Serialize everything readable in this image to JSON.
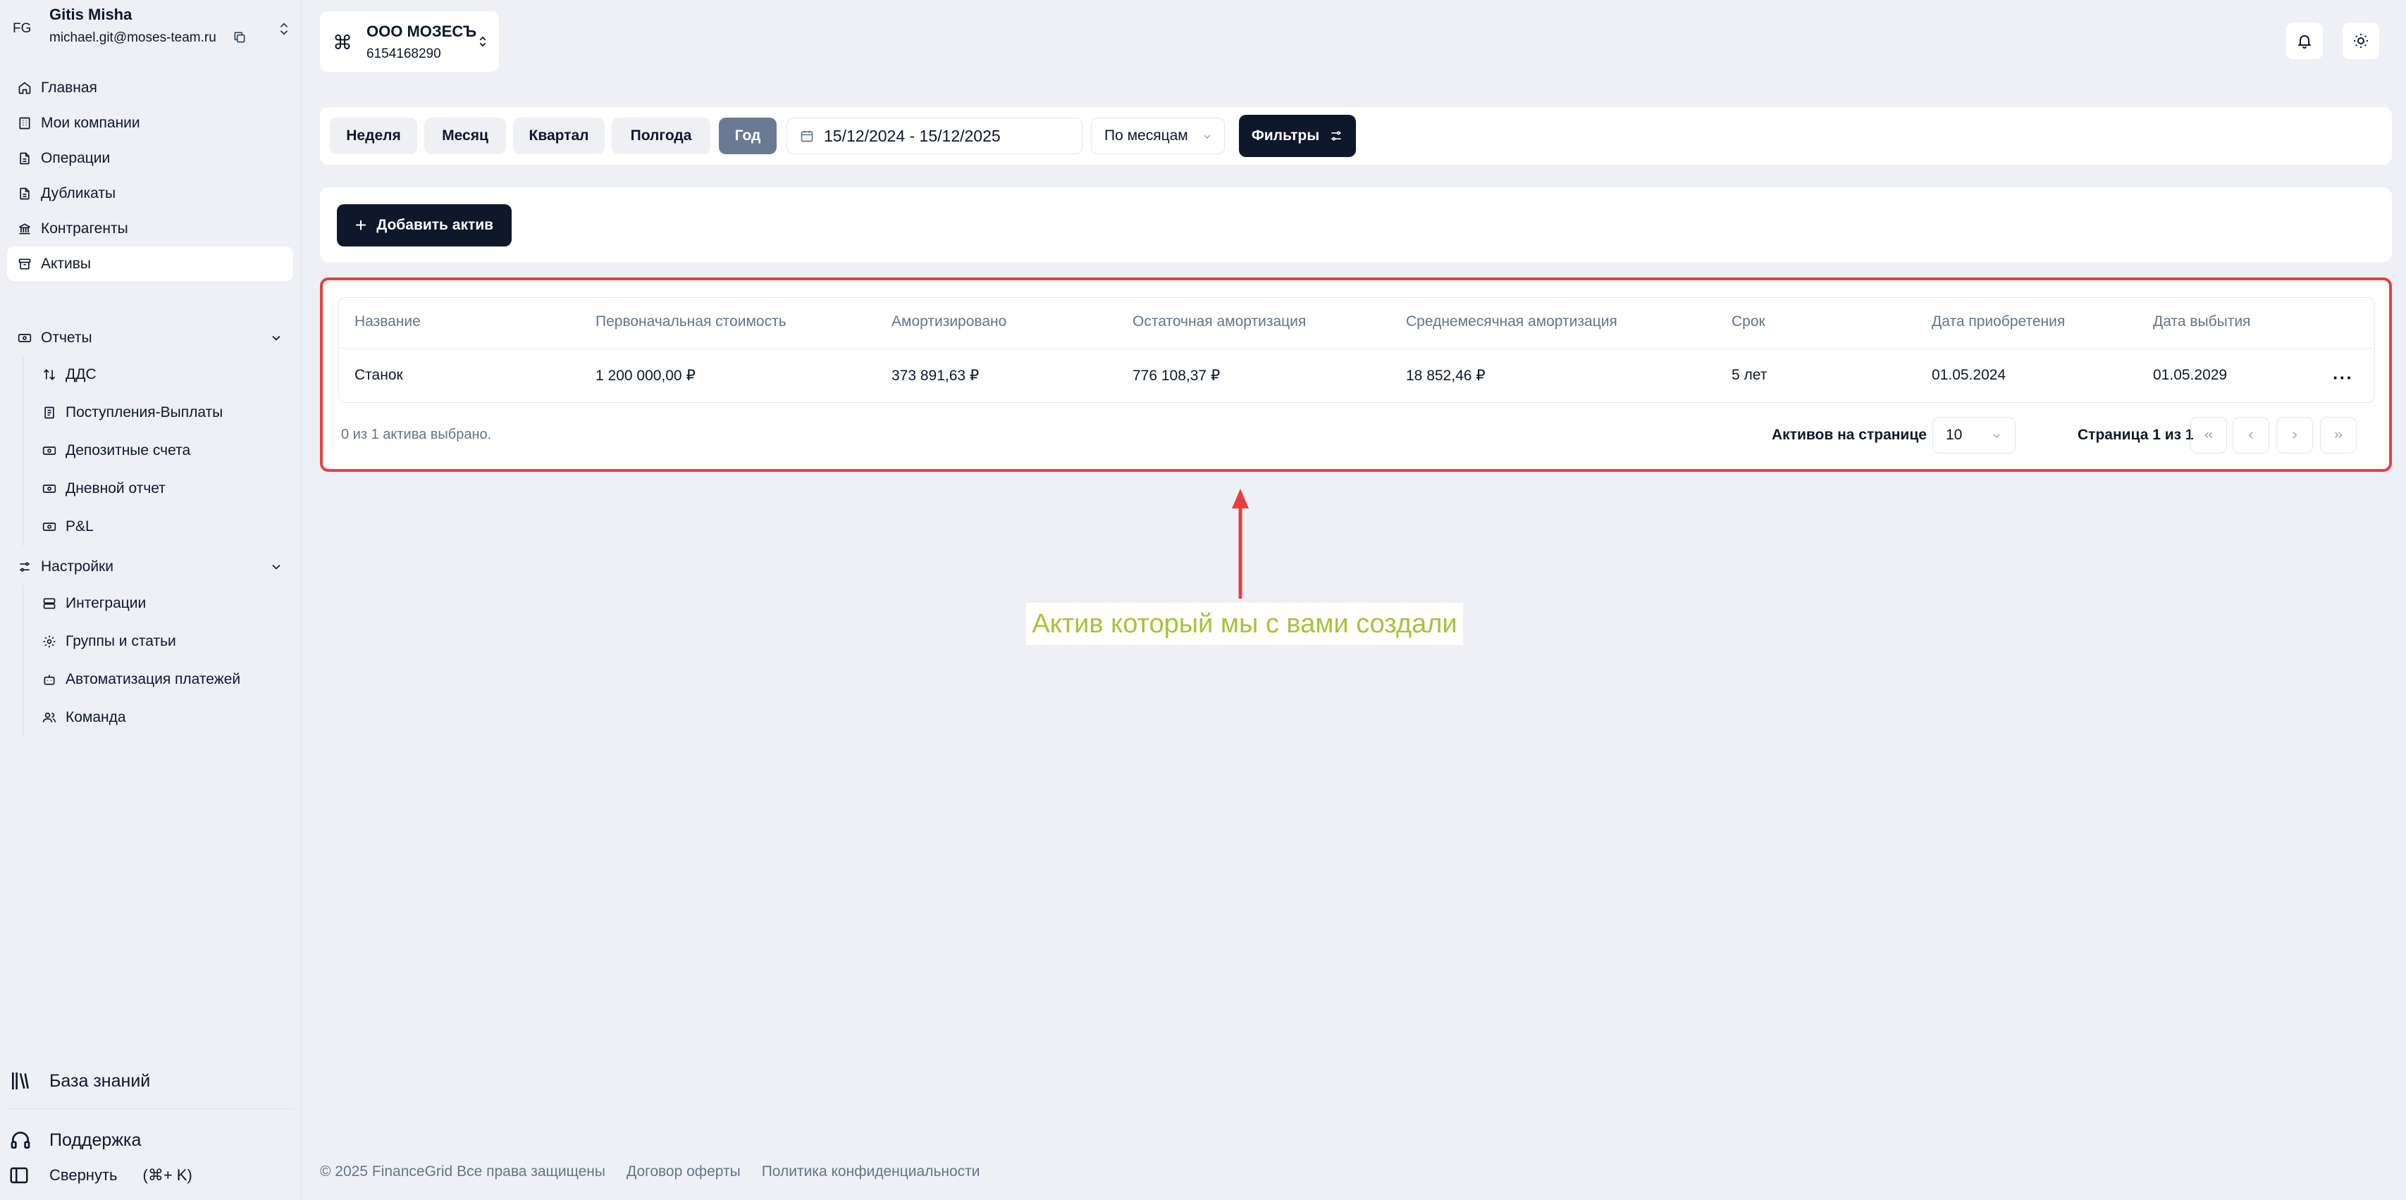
{
  "user": {
    "initials": "FG",
    "name": "Gitis Misha",
    "email": "michael.git@moses-team.ru"
  },
  "nav": {
    "main": [
      {
        "label": "Главная",
        "icon": "home-icon"
      },
      {
        "label": "Мои компании",
        "icon": "building-icon"
      },
      {
        "label": "Операции",
        "icon": "file-icon"
      },
      {
        "label": "Дубликаты",
        "icon": "file-icon"
      },
      {
        "label": "Контрагенты",
        "icon": "bank-icon"
      },
      {
        "label": "Активы",
        "icon": "archive-icon",
        "active": true
      }
    ],
    "reports": {
      "label": "Отчеты",
      "items": [
        {
          "label": "ДДС",
          "icon": "arrows-updown-icon"
        },
        {
          "label": "Поступления-Выплаты",
          "icon": "document-icon"
        },
        {
          "label": "Депозитные счета",
          "icon": "banknote-icon"
        },
        {
          "label": "Дневной отчет",
          "icon": "banknote-icon"
        },
        {
          "label": "P&L",
          "icon": "banknote-icon"
        }
      ]
    },
    "settings": {
      "label": "Настройки",
      "items": [
        {
          "label": "Интеграции",
          "icon": "server-icon"
        },
        {
          "label": "Группы и статьи",
          "icon": "gear-icon"
        },
        {
          "label": "Автоматизация платежей",
          "icon": "robot-icon"
        },
        {
          "label": "Команда",
          "icon": "users-icon"
        }
      ]
    }
  },
  "bottom": {
    "knowledge": "База знаний",
    "support": "Поддержка",
    "collapse": "Свернуть",
    "collapse_shortcut": "(⌘+ K)"
  },
  "company": {
    "symbol": "⌘",
    "name": "ООО МОЗЕСЪ",
    "inn": "6154168290"
  },
  "filters": {
    "periods": [
      "Неделя",
      "Месяц",
      "Квартал",
      "Полгода",
      "Год"
    ],
    "active_period": "Год",
    "date_range": "15/12/2024 - 15/12/2025",
    "grouping": "По месяцам",
    "filters_label": "Фильтры"
  },
  "actions": {
    "add_asset": "Добавить актив"
  },
  "table": {
    "headers": [
      "Название",
      "Первоначальная стоимость",
      "Амортизировано",
      "Остаточная амортизация",
      "Среднемесячная амортизация",
      "Срок",
      "Дата приобретения",
      "Дата выбытия"
    ],
    "rows": [
      [
        "Станок",
        "1 200 000,00 ₽",
        "373 891,63 ₽",
        "776 108,37 ₽",
        "18 852,46 ₽",
        "5 лет",
        "01.05.2024",
        "01.05.2029"
      ]
    ],
    "row_menu": "···",
    "selection_info": "0 из 1 актива выбрано.",
    "per_page_label": "Активов на странице",
    "per_page_value": "10",
    "page_info": "Страница 1 из 1"
  },
  "annotation": {
    "text": "Актив который мы с вами создали",
    "color": "#a4c43a",
    "frame_color": "#e63f3f"
  },
  "footer": {
    "copyright": "© 2025 FinanceGrid Все права защищены",
    "offer": "Договор оферты",
    "privacy": "Политика конфиденциальности"
  }
}
